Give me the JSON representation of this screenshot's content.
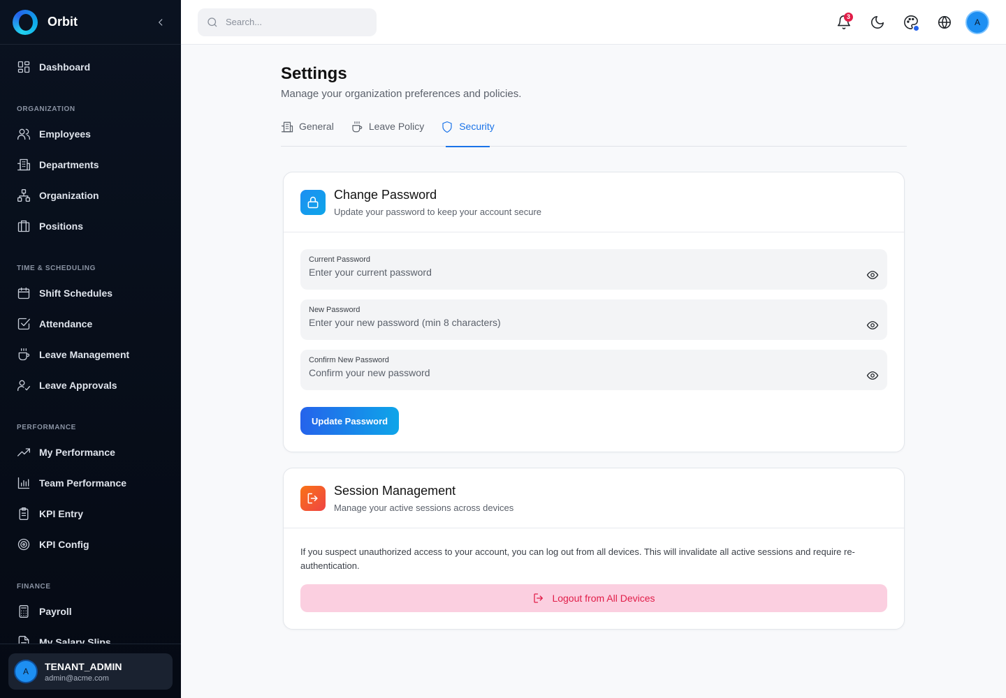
{
  "app": {
    "name": "Orbit"
  },
  "sidebar": {
    "dashboard": "Dashboard",
    "sections": [
      {
        "title": "ORGANIZATION",
        "items": [
          "Employees",
          "Departments",
          "Organization",
          "Positions"
        ]
      },
      {
        "title": "TIME & SCHEDULING",
        "items": [
          "Shift Schedules",
          "Attendance",
          "Leave Management",
          "Leave Approvals"
        ]
      },
      {
        "title": "PERFORMANCE",
        "items": [
          "My Performance",
          "Team Performance",
          "KPI Entry",
          "KPI Config"
        ]
      },
      {
        "title": "FINANCE",
        "items": [
          "Payroll",
          "My Salary Slips"
        ]
      }
    ],
    "user": {
      "initial": "A",
      "role": "TENANT_ADMIN",
      "email": "admin@acme.com"
    }
  },
  "topbar": {
    "search_placeholder": "Search...",
    "notification_count": "3",
    "avatar_initial": "A"
  },
  "page": {
    "title": "Settings",
    "subtitle": "Manage your organization preferences and policies.",
    "tabs": [
      "General",
      "Leave Policy",
      "Security"
    ],
    "active_tab": "Security"
  },
  "change_password": {
    "title": "Change Password",
    "description": "Update your password to keep your account secure",
    "fields": [
      {
        "label": "Current Password",
        "placeholder": "Enter your current password"
      },
      {
        "label": "New Password",
        "placeholder": "Enter your new password (min 8 characters)"
      },
      {
        "label": "Confirm New Password",
        "placeholder": "Confirm your new password"
      }
    ],
    "submit_label": "Update Password"
  },
  "session_management": {
    "title": "Session Management",
    "description": "Manage your active sessions across devices",
    "text": "If you suspect unauthorized access to your account, you can log out from all devices. This will invalidate all active sessions and require re-authentication.",
    "button_label": "Logout from All Devices"
  },
  "colors": {
    "accent": "#1a73e8",
    "sidebar_bg": "#0a1220",
    "danger": "#e11d48",
    "danger_bg": "#fbcfe0"
  }
}
